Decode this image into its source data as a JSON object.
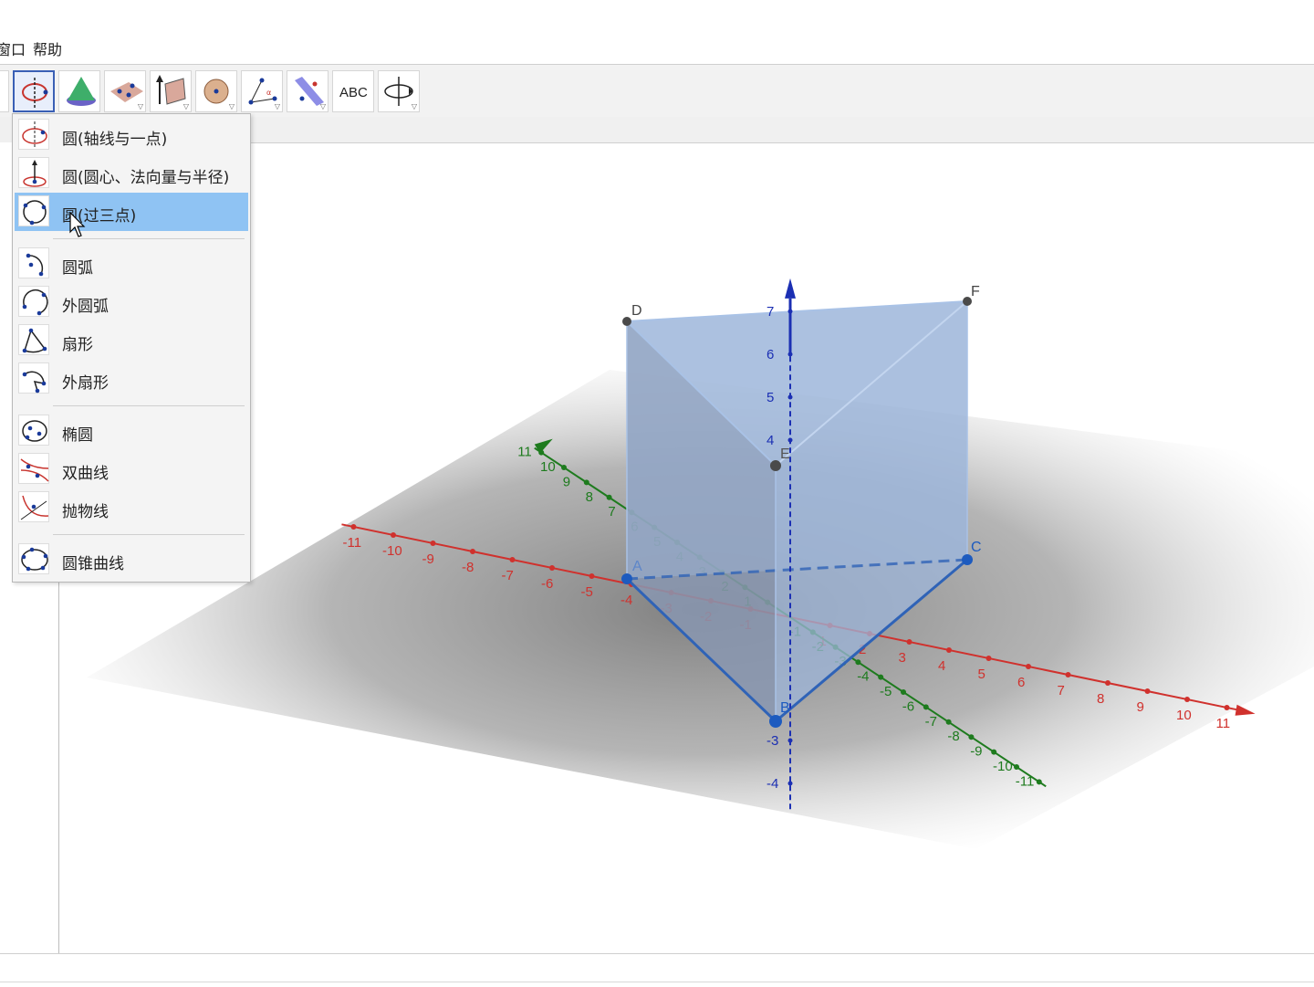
{
  "menubar": {
    "window": "窗口",
    "help": "帮助"
  },
  "toolbar": {
    "tools": [
      {
        "name": "circle-tool-icon",
        "selected": true
      },
      {
        "name": "cone-tool-icon"
      },
      {
        "name": "plane-tool-icon"
      },
      {
        "name": "prism-extrude-tool-icon"
      },
      {
        "name": "sphere-tool-icon"
      },
      {
        "name": "angle-tool-icon"
      },
      {
        "name": "reflect-tool-icon"
      },
      {
        "name": "text-tool-icon",
        "label": "ABC"
      },
      {
        "name": "rotate-view-tool-icon"
      }
    ]
  },
  "dropdown": {
    "items": [
      {
        "label": "圆(轴线与一点)",
        "icon": "circle-axis-point-icon"
      },
      {
        "label": "圆(圆心、法向量与半径)",
        "icon": "circle-center-normal-radius-icon"
      },
      {
        "label": "圆(过三点)",
        "icon": "circle-three-points-icon",
        "selected": true
      },
      {
        "label": "圆弧",
        "icon": "arc-icon"
      },
      {
        "label": "外圆弧",
        "icon": "circumcircular-arc-icon"
      },
      {
        "label": "扇形",
        "icon": "sector-icon"
      },
      {
        "label": "外扇形",
        "icon": "circumcircular-sector-icon"
      },
      {
        "label": "椭圆",
        "icon": "ellipse-icon"
      },
      {
        "label": "双曲线",
        "icon": "hyperbola-icon"
      },
      {
        "label": "抛物线",
        "icon": "parabola-icon"
      },
      {
        "label": "圆锥曲线",
        "icon": "conic-icon"
      }
    ]
  },
  "view3d": {
    "points": [
      "A",
      "B",
      "C",
      "D",
      "E",
      "F"
    ],
    "x_ticks": [
      "-11",
      "-10",
      "-9",
      "-8",
      "-7",
      "-6",
      "-5",
      "-4",
      "-3",
      "-2",
      "-1",
      "0",
      "1",
      "2",
      "3",
      "4",
      "5",
      "6",
      "7",
      "8",
      "9",
      "10",
      "11"
    ],
    "y_ticks": [
      "-11",
      "-10",
      "-9",
      "-8",
      "-7",
      "-6",
      "-5",
      "-4",
      "-3",
      "-2",
      "-1",
      "1",
      "2",
      "3",
      "4",
      "5",
      "6",
      "7",
      "8",
      "9",
      "10",
      "11"
    ],
    "z_ticks": [
      "7",
      "6",
      "5",
      "4",
      "-3",
      "-4"
    ],
    "colors": {
      "x_axis": "#d0312d",
      "y_axis": "#1e7b1e",
      "z_axis": "#1b2fb3",
      "prism_fill": "#9db6da",
      "prism_edge": "#2f63b7"
    }
  }
}
